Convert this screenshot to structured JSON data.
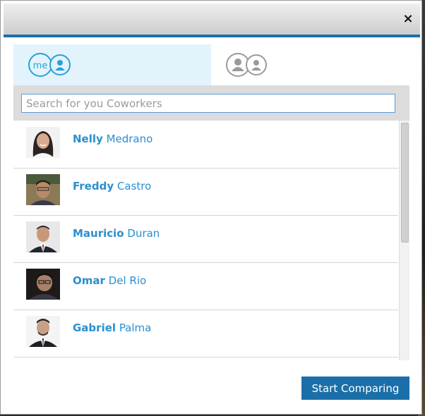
{
  "dialog": {
    "close_label": "×"
  },
  "tabs": [
    {
      "id": "me",
      "label": "me",
      "icon": "me-user-icon",
      "active": true
    },
    {
      "id": "compare",
      "icon": "two-users-icon",
      "active": false
    }
  ],
  "search": {
    "placeholder": "Search for you Coworkers",
    "value": ""
  },
  "coworkers": [
    {
      "first": "Nelly",
      "last": "Medrano",
      "avatar": "photo-woman-long-dark-hair"
    },
    {
      "first": "Freddy",
      "last": "Castro",
      "avatar": "photo-man-smiling"
    },
    {
      "first": "Mauricio",
      "last": "Duran",
      "avatar": "photo-man-suit"
    },
    {
      "first": "Omar",
      "last": "Del Rio",
      "avatar": "photo-man-glasses"
    },
    {
      "first": "Gabriel",
      "last": "Palma",
      "avatar": "photo-man-suit-tie"
    }
  ],
  "actions": {
    "start_label": "Start Comparing"
  },
  "colors": {
    "accent": "#1b6fa8",
    "name_link": "#2a8fcf",
    "active_tab_bg": "#e3f3fc"
  }
}
